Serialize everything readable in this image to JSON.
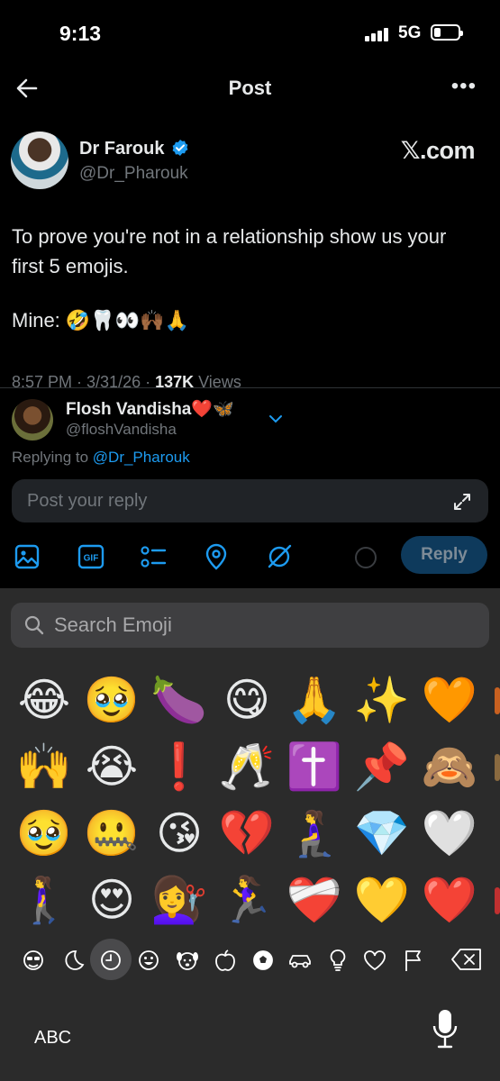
{
  "status_bar": {
    "time": "9:13",
    "network": "5G"
  },
  "header": {
    "title": "Post"
  },
  "tweet": {
    "author_name": "Dr Farouk",
    "author_handle": "@Dr_Pharouk",
    "source_watermark": "𝕏.com",
    "text": "To prove you're not in a relationship show us your first 5 emojis.",
    "mine_line": "Mine: 🤣🦷👀🙌🏾🙏",
    "meta_time": "8:57 PM · 3/31/26 · ",
    "meta_views_count": "137K",
    "meta_views_label": " Views"
  },
  "reply": {
    "user_name": "Flosh Vandisha❤️🦋",
    "user_handle": "@floshVandisha",
    "replying_to_prefix": "Replying to ",
    "replying_to_handle": "@Dr_Pharouk",
    "input_placeholder": "Post your reply",
    "reply_button": "Reply"
  },
  "keyboard": {
    "search_placeholder": "Search Emoji",
    "emoji_rows": [
      [
        "😂",
        "🥹",
        "🍆",
        "😋",
        "🙏",
        "✨",
        "🧡"
      ],
      [
        "🙌",
        "😭",
        "❗",
        "🥂",
        "✝️",
        "📌",
        "🙈"
      ],
      [
        "🥹",
        "🤐",
        "😘",
        "💔",
        "🧎‍♀️",
        "💎",
        "🤍"
      ],
      [
        "🚶‍♀️",
        "😍",
        "💇‍♀️",
        "🏃‍♀️",
        "❤️‍🩹",
        "💛",
        "❤️"
      ]
    ],
    "abc_label": "ABC",
    "categories": [
      "smileys-people-icon",
      "moon-icon",
      "recent-clock-icon",
      "smiley-icon",
      "animal-icon",
      "food-icon",
      "activity-icon",
      "travel-icon",
      "objects-icon",
      "symbols-icon",
      "flags-icon"
    ],
    "selected_category": "recent-clock-icon"
  },
  "colors": {
    "accent_blue": "#1d9bf0",
    "background": "#000000",
    "keyboard_bg": "#2b2b2b",
    "reply_button_bg": "#0e3a5c"
  }
}
